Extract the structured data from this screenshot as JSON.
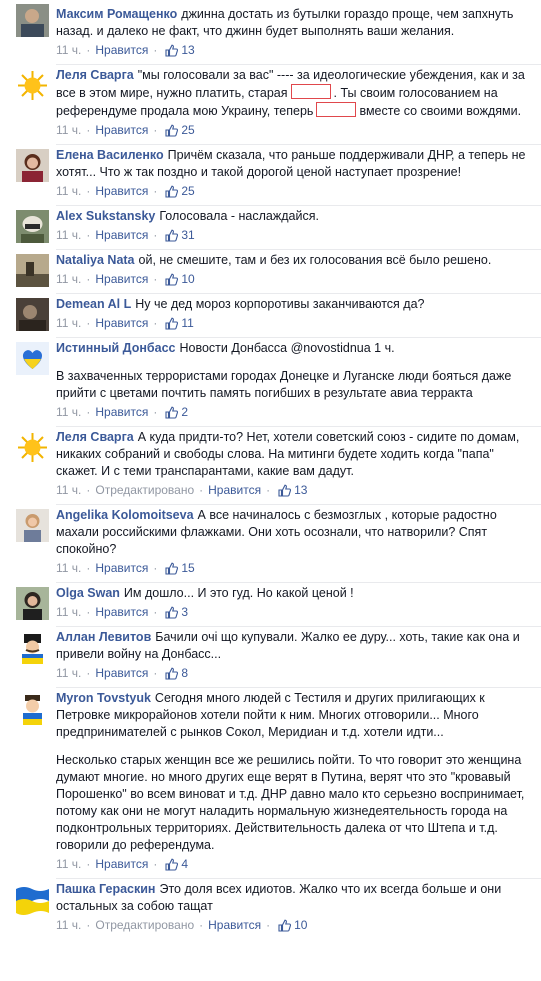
{
  "ui": {
    "like": "Нравится",
    "edited": "Отредактировано",
    "dot": "·",
    "accent": "#3b5998",
    "meta_color": "#9197a3",
    "redaction_color": "#e0474c"
  },
  "comments": [
    {
      "author": "Максим Ромащенко",
      "avatar": "photo-man-icon",
      "time": "11 ч.",
      "text": "джинна достать из бутылки гораздо проще, чем запхнуть назад. и далеко не факт, что джинн будет выполнять ваши желания.",
      "likes": "13"
    },
    {
      "author": "Леля Сварга",
      "avatar": "sun-icon",
      "time": "11 ч.",
      "text_a": "\"мы голосовали за вас\" ---- за идеологические убеждения, как и за все в этом мире, нужно платить, старая",
      "text_b": ". Ты своим голосованием на референдуме продала мою Украину, теперь",
      "text_c": "вместе со своими вождями.",
      "likes": "25"
    },
    {
      "author": "Елена Василенко",
      "avatar": "photo-woman-icon",
      "time": "11 ч.",
      "text": "Причём сказала, что раньше поддерживали ДНР, а теперь не хотят... Что ж так поздно и такой дорогой ценой наступает прозрение!",
      "likes": "25"
    },
    {
      "author": "Alex Sukstansky",
      "avatar": "photo-helmet-icon",
      "time": "11 ч.",
      "text": "Голосовала - наслаждайся.",
      "likes": "31"
    },
    {
      "author": "Nataliya Nata",
      "avatar": "photo-landscape-icon",
      "time": "11 ч.",
      "text": "ой, не смешите, там и без их голосования всё было решено.",
      "likes": "10"
    },
    {
      "author": "Demean Al L",
      "avatar": "photo-dark-icon",
      "time": "11 ч.",
      "text": "Ну че дед мороз корпоротивы заканчиваются да?",
      "likes": "11"
    },
    {
      "author": "Истинный Донбасс",
      "avatar": "heart-flag-icon",
      "time": "11 ч.",
      "text": "Новости Донбасса @novostidnua 1 ч.",
      "para": "В захваченных террористами городах Донецке и Луганске люди бояться даже прийти с цветами почтить память погибших в результате авиа терракта",
      "likes": "2"
    },
    {
      "author": "Леля Сварга",
      "avatar": "sun-icon",
      "time": "11 ч.",
      "edited": true,
      "text": "А куда придти-то? Нет, хотели советский союз - сидите по домам, никаких собраний и свободы слова. На митинги будете ходить когда \"папа\" скажет. И с теми транспарантами, какие вам дадут.",
      "likes": "13"
    },
    {
      "author": "Angelika Kolomoitseva",
      "avatar": "photo-woman2-icon",
      "time": "11 ч.",
      "text": "А все начиналось с безмозглых , которые радостно махали российскими флажками. Они хоть осознали, что натворили? Спят спокойно?",
      "likes": "15"
    },
    {
      "author": "Olga Swan",
      "avatar": "photo-woman3-icon",
      "time": "11 ч.",
      "text": "Им дошло... И это гуд. Но какой ценой !",
      "likes": "3"
    },
    {
      "author": "Аллан Левитов",
      "avatar": "cossack-icon",
      "time": "11 ч.",
      "text": "Бачили очі що купували. Жалко ее дуру... хоть, такие как она и привели войну на Донбасс...",
      "likes": "8"
    },
    {
      "author": "Myron Tovstyuk",
      "avatar": "cartoon-man-icon",
      "time": "11 ч.",
      "text": "Сегодня много людей с Тестиля и других прилигающих к Петровке микрорайонов хотели пойти к ним. Многих отговорили... Много предпринимателей с рынков Сокол, Меридиан и т.д. хотели идти...",
      "para": "Несколько старых женщин все же решились пойти. То что говорит это женщина думают многие. но много других еще верят в Путина, верят что это \"кровавый Порошенко\" во всем виноват и т.д. ДНР давно мало кто серьезно воспринимает, потому как они не могут наладить нормальную жизнедеятельность города на подконтрольных территориях. Действительность далека от что Штепа и т.д. говорили до референдума.",
      "likes": "4"
    },
    {
      "author": "Пашка Гераскин",
      "avatar": "ukraine-flag-icon",
      "time": "11 ч.",
      "edited": true,
      "text": "Это доля всех идиотов. Жалко что их всегда больше и они остальных за собою тащат",
      "likes": "10"
    }
  ]
}
